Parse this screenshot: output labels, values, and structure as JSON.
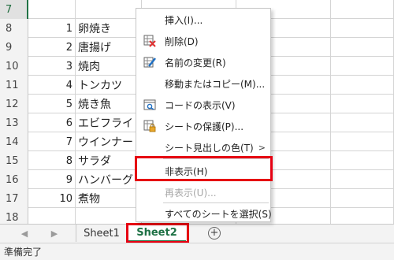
{
  "rows": [
    {
      "num": "7",
      "a": "",
      "b": "",
      "active": true
    },
    {
      "num": "8",
      "a": "1",
      "b": "卵焼き"
    },
    {
      "num": "9",
      "a": "2",
      "b": "唐揚げ"
    },
    {
      "num": "10",
      "a": "3",
      "b": "焼肉"
    },
    {
      "num": "11",
      "a": "4",
      "b": "トンカツ"
    },
    {
      "num": "12",
      "a": "5",
      "b": "焼き魚"
    },
    {
      "num": "13",
      "a": "6",
      "b": "エビフライ"
    },
    {
      "num": "14",
      "a": "7",
      "b": "ウインナー"
    },
    {
      "num": "15",
      "a": "8",
      "b": "サラダ"
    },
    {
      "num": "16",
      "a": "9",
      "b": "ハンバーグ"
    },
    {
      "num": "17",
      "a": "10",
      "b": "煮物"
    },
    {
      "num": "18",
      "a": "",
      "b": ""
    }
  ],
  "tabs": {
    "sheet1": "Sheet1",
    "sheet2": "Sheet2",
    "add": "+"
  },
  "status": {
    "text": "準備完了"
  },
  "menu": {
    "items": [
      {
        "label": "挿入(I)...",
        "icon": "none",
        "disabled": false
      },
      {
        "label": "削除(D)",
        "icon": "delete-sheet-icon",
        "disabled": false
      },
      {
        "label": "名前の変更(R)",
        "icon": "rename-icon",
        "disabled": false
      },
      {
        "label": "移動またはコピー(M)...",
        "icon": "none",
        "disabled": false
      },
      {
        "label": "コードの表示(V)",
        "icon": "view-code-icon",
        "disabled": false
      },
      {
        "label": "シートの保護(P)...",
        "icon": "protect-sheet-icon",
        "disabled": false
      },
      {
        "label": "シート見出しの色(T)",
        "icon": "none",
        "disabled": false,
        "submenu": true
      },
      {
        "label": "非表示(H)",
        "icon": "none",
        "disabled": false,
        "highlighted": true
      },
      {
        "label": "再表示(U)...",
        "icon": "none",
        "disabled": true
      },
      {
        "label": "すべてのシートを選択(S)",
        "icon": "none",
        "disabled": false
      }
    ]
  },
  "colors": {
    "accent": "#217346",
    "highlight": "#e60012",
    "grid_line": "#d4d4d4"
  }
}
